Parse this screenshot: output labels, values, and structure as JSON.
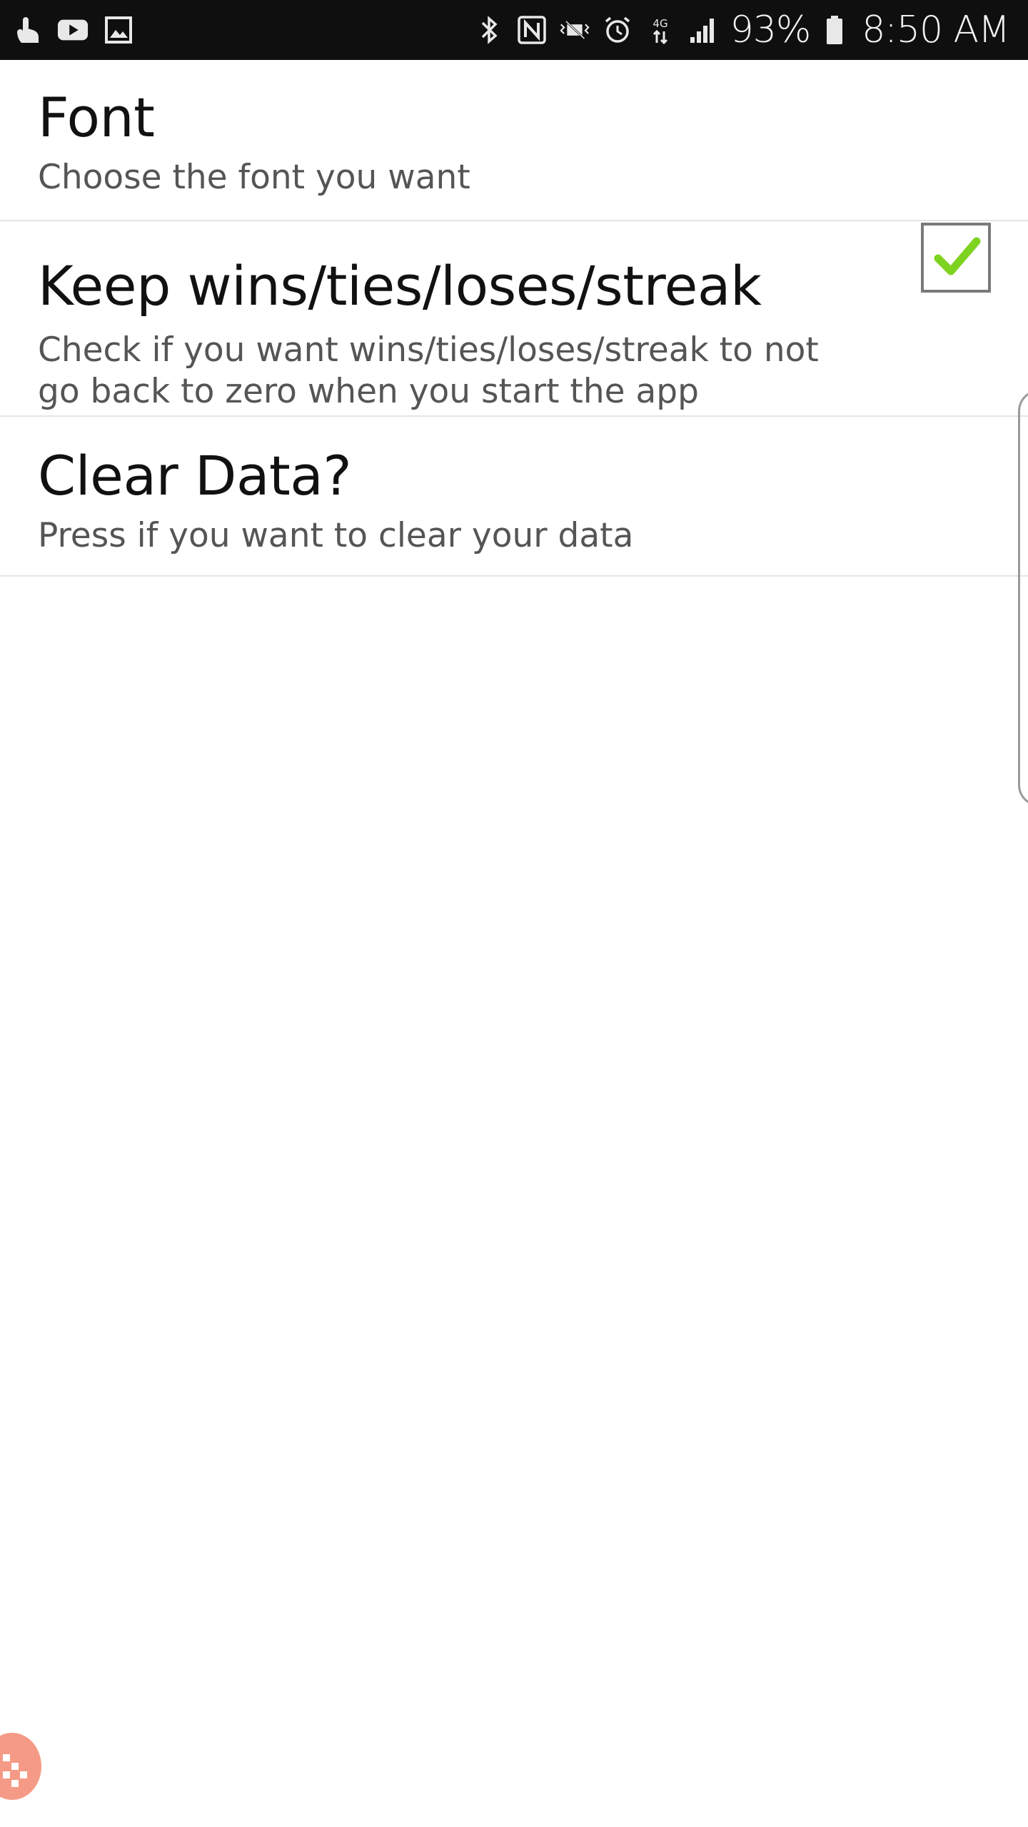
{
  "status_bar": {
    "left_icons": [
      "touch-icon",
      "youtube-icon",
      "gallery-icon"
    ],
    "right_icons": [
      "bluetooth-icon",
      "nfc-icon",
      "vibrate-icon",
      "alarm-icon",
      "data-4g-icon",
      "signal-icon"
    ],
    "battery": "93%",
    "time": "8:50 AM"
  },
  "preferences": [
    {
      "title": "Font",
      "summary": "Choose the font you want"
    },
    {
      "title": "Keep wins/ties/loses/streak",
      "summary": "Check if you want wins/ties/loses/streak to not go back to zero when you start the app",
      "checked": true
    },
    {
      "title": "Clear Data?",
      "summary": "Press if you want to clear your data"
    }
  ],
  "colors": {
    "status_bar_bg": "#0f0f0f",
    "check_green": "#7ed321",
    "bubble": "#f59a86"
  }
}
